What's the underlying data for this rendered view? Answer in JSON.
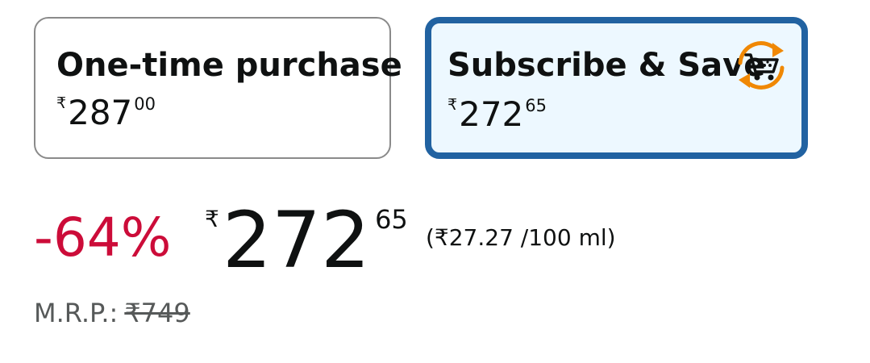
{
  "options": {
    "one_time": {
      "title": "One-time purchase",
      "currency": "₹",
      "price_whole": "287",
      "price_fraction": "00"
    },
    "subscribe": {
      "title": "Subscribe & Save",
      "currency": "₹",
      "price_whole": "272",
      "price_fraction": "65",
      "icon": "subscribe-cart-icon",
      "selected_border_color": "#2162a1",
      "selected_background_color": "#edf8ff",
      "icon_color": "#f08804"
    }
  },
  "price_block": {
    "discount": "-64%",
    "discount_color": "#cc0c39",
    "currency": "₹",
    "price_whole": "272",
    "price_fraction": "65",
    "unit_price": "(₹27.27 /100 ml)",
    "mrp_label": "M.R.P.:",
    "mrp_value": "₹749"
  }
}
